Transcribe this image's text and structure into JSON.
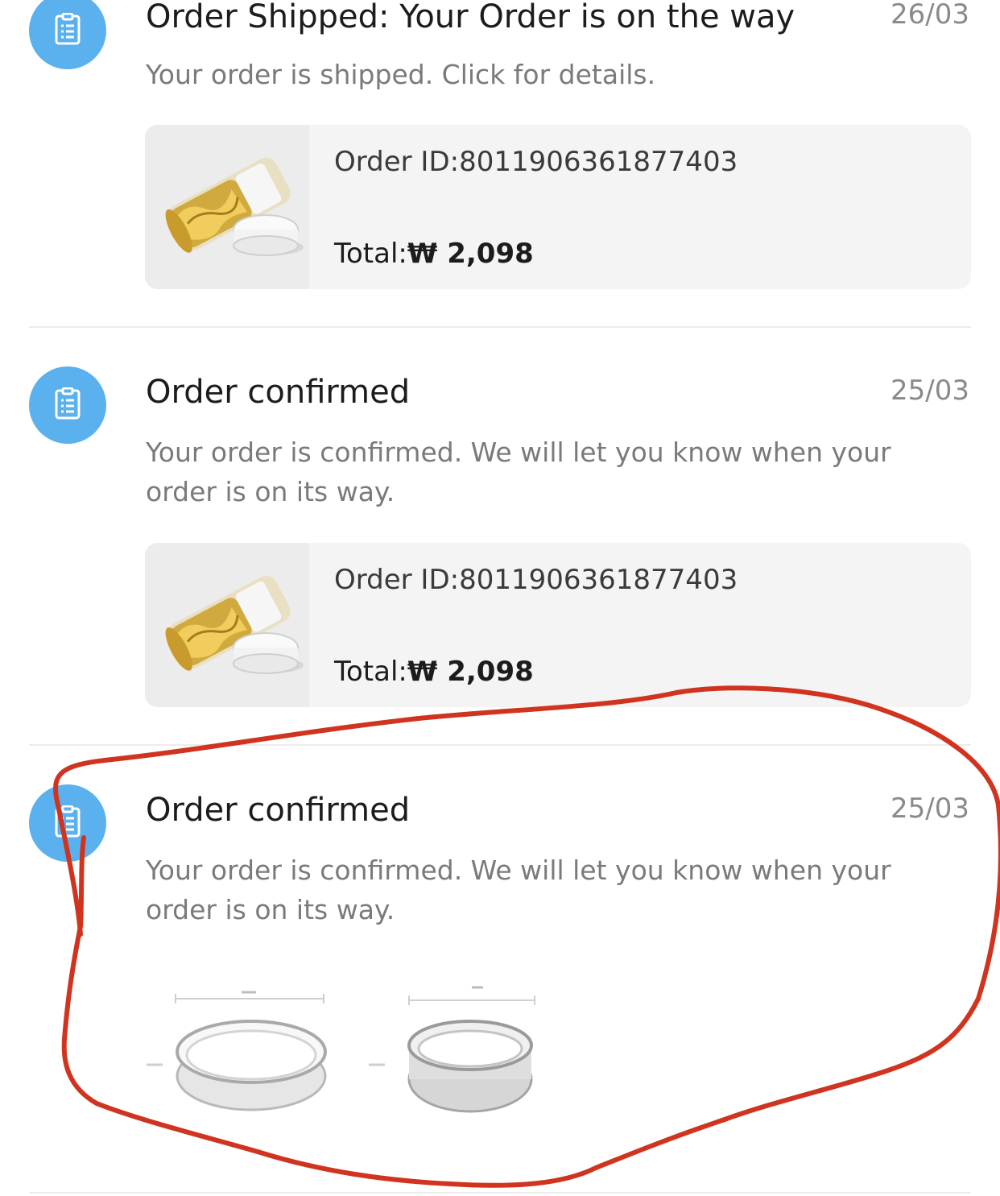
{
  "notifications": [
    {
      "title": "Order Shipped: Your Order is on the way",
      "date": "26/03",
      "description": "Your order is shipped. Click for details.",
      "order_id_label": "Order ID:",
      "order_id": "8011906361877403",
      "total_label": "Total:",
      "total_value": "₩ 2,098"
    },
    {
      "title": "Order confirmed",
      "date": "25/03",
      "description": "Your order is confirmed. We will let you know when your order is on its way.",
      "order_id_label": "Order ID:",
      "order_id": "8011906361877403",
      "total_label": "Total:",
      "total_value": "₩ 2,098"
    },
    {
      "title": "Order confirmed",
      "date": "25/03",
      "description": "Your order is confirmed. We will let you know when your order is on its way."
    }
  ],
  "colors": {
    "accent": "#5bb1ee",
    "annotation": "#d0341f",
    "card_bg": "#f4f4f4"
  },
  "icons": {
    "notification": "clipboard-list-icon"
  }
}
